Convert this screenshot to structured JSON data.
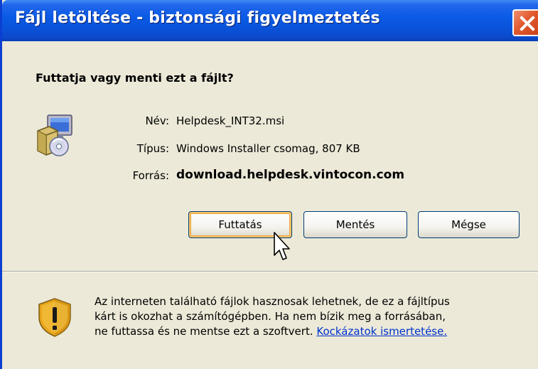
{
  "window": {
    "title": "Fájl letöltése - biztonsági figyelmeztetés"
  },
  "dialog": {
    "question": "Futtatja vagy menti ezt a fájlt?",
    "file": {
      "name_label": "Név:",
      "name_value": "Helpdesk_INT32.msi",
      "type_label": "Típus:",
      "type_value": "Windows Installer csomag, 807 KB",
      "source_label": "Forrás:",
      "source_value": "download.helpdesk.vintocon.com"
    },
    "buttons": {
      "run": "Futtatás",
      "save": "Mentés",
      "cancel": "Mégse"
    },
    "warning": {
      "line1": "Az interneten található fájlok hasznosak lehetnek, de ez a fájltípus",
      "line2": "kárt is okozhat a számítógépben. Ha nem bízik meg a forrásában,",
      "line3": "ne futtassa és ne mentse ezt a szoftvert.",
      "link": "Kockázatok ismertetése."
    }
  },
  "colors": {
    "titlebar": "#0A52D8",
    "close_button": "#E2582F",
    "dialog_bg": "#ECE9D8",
    "link": "#0033CC",
    "default_button_highlight": "#F7C56A"
  },
  "icons": {
    "file_icon": "installer-package-icon",
    "warning_icon": "security-shield-icon",
    "close_icon": "close-x-icon",
    "cursor": "mouse-pointer-icon"
  }
}
